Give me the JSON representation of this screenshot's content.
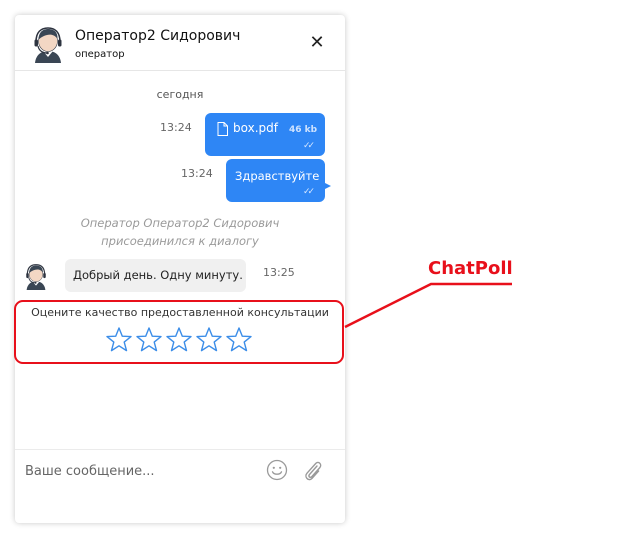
{
  "header": {
    "operator_name": "Оператор2 Сидорович",
    "operator_role": "оператор",
    "close_label": "✕"
  },
  "chat": {
    "date_separator": "сегодня",
    "messages": [
      {
        "type": "file",
        "direction": "outgoing",
        "time": "13:24",
        "file_name": "box.pdf",
        "file_size": "46 kb",
        "status": "✓✓"
      },
      {
        "type": "text",
        "direction": "outgoing",
        "time": "13:24",
        "text": "Здравствуйте",
        "status": "✓✓"
      },
      {
        "type": "system",
        "line1": "Оператор Оператор2 Сидорович",
        "line2": "присоединился к диалогу"
      },
      {
        "type": "text",
        "direction": "incoming",
        "time": "13:25",
        "text": "Добрый день. Одну минуту."
      }
    ]
  },
  "poll": {
    "title": "Оцените качество предоставленной консультации",
    "max_rating": 5,
    "current_rating": 0
  },
  "composer": {
    "placeholder": "Ваше сообщение...",
    "value": ""
  },
  "annotation": {
    "label": "ChatPoll",
    "color": "#e8101b"
  },
  "colors": {
    "accent": "#2e86f5",
    "star_outline": "#3b8de8"
  },
  "icons": [
    "operator-avatar-icon",
    "close-icon",
    "file-icon",
    "double-check-icon",
    "star-icon",
    "emoji-icon",
    "paperclip-icon"
  ]
}
